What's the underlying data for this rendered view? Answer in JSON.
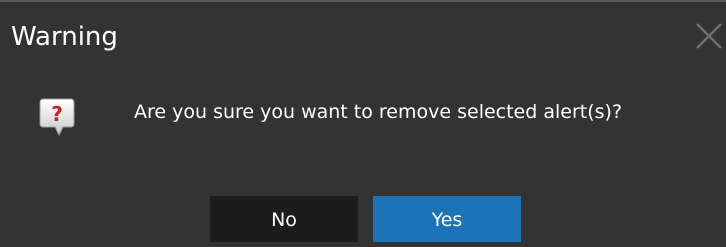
{
  "dialog": {
    "title": "Warning",
    "close_icon": "close-icon",
    "question_icon": "question-bubble-icon",
    "message": "Are you sure you want to remove selected alert(s)?",
    "buttons": {
      "no_label": "No",
      "yes_label": "Yes"
    }
  },
  "colors": {
    "background": "#333333",
    "text": "#ffffff",
    "no_button": "#1c1c1c",
    "yes_button": "#1c73b8",
    "question_mark": "#cc1f2a"
  }
}
